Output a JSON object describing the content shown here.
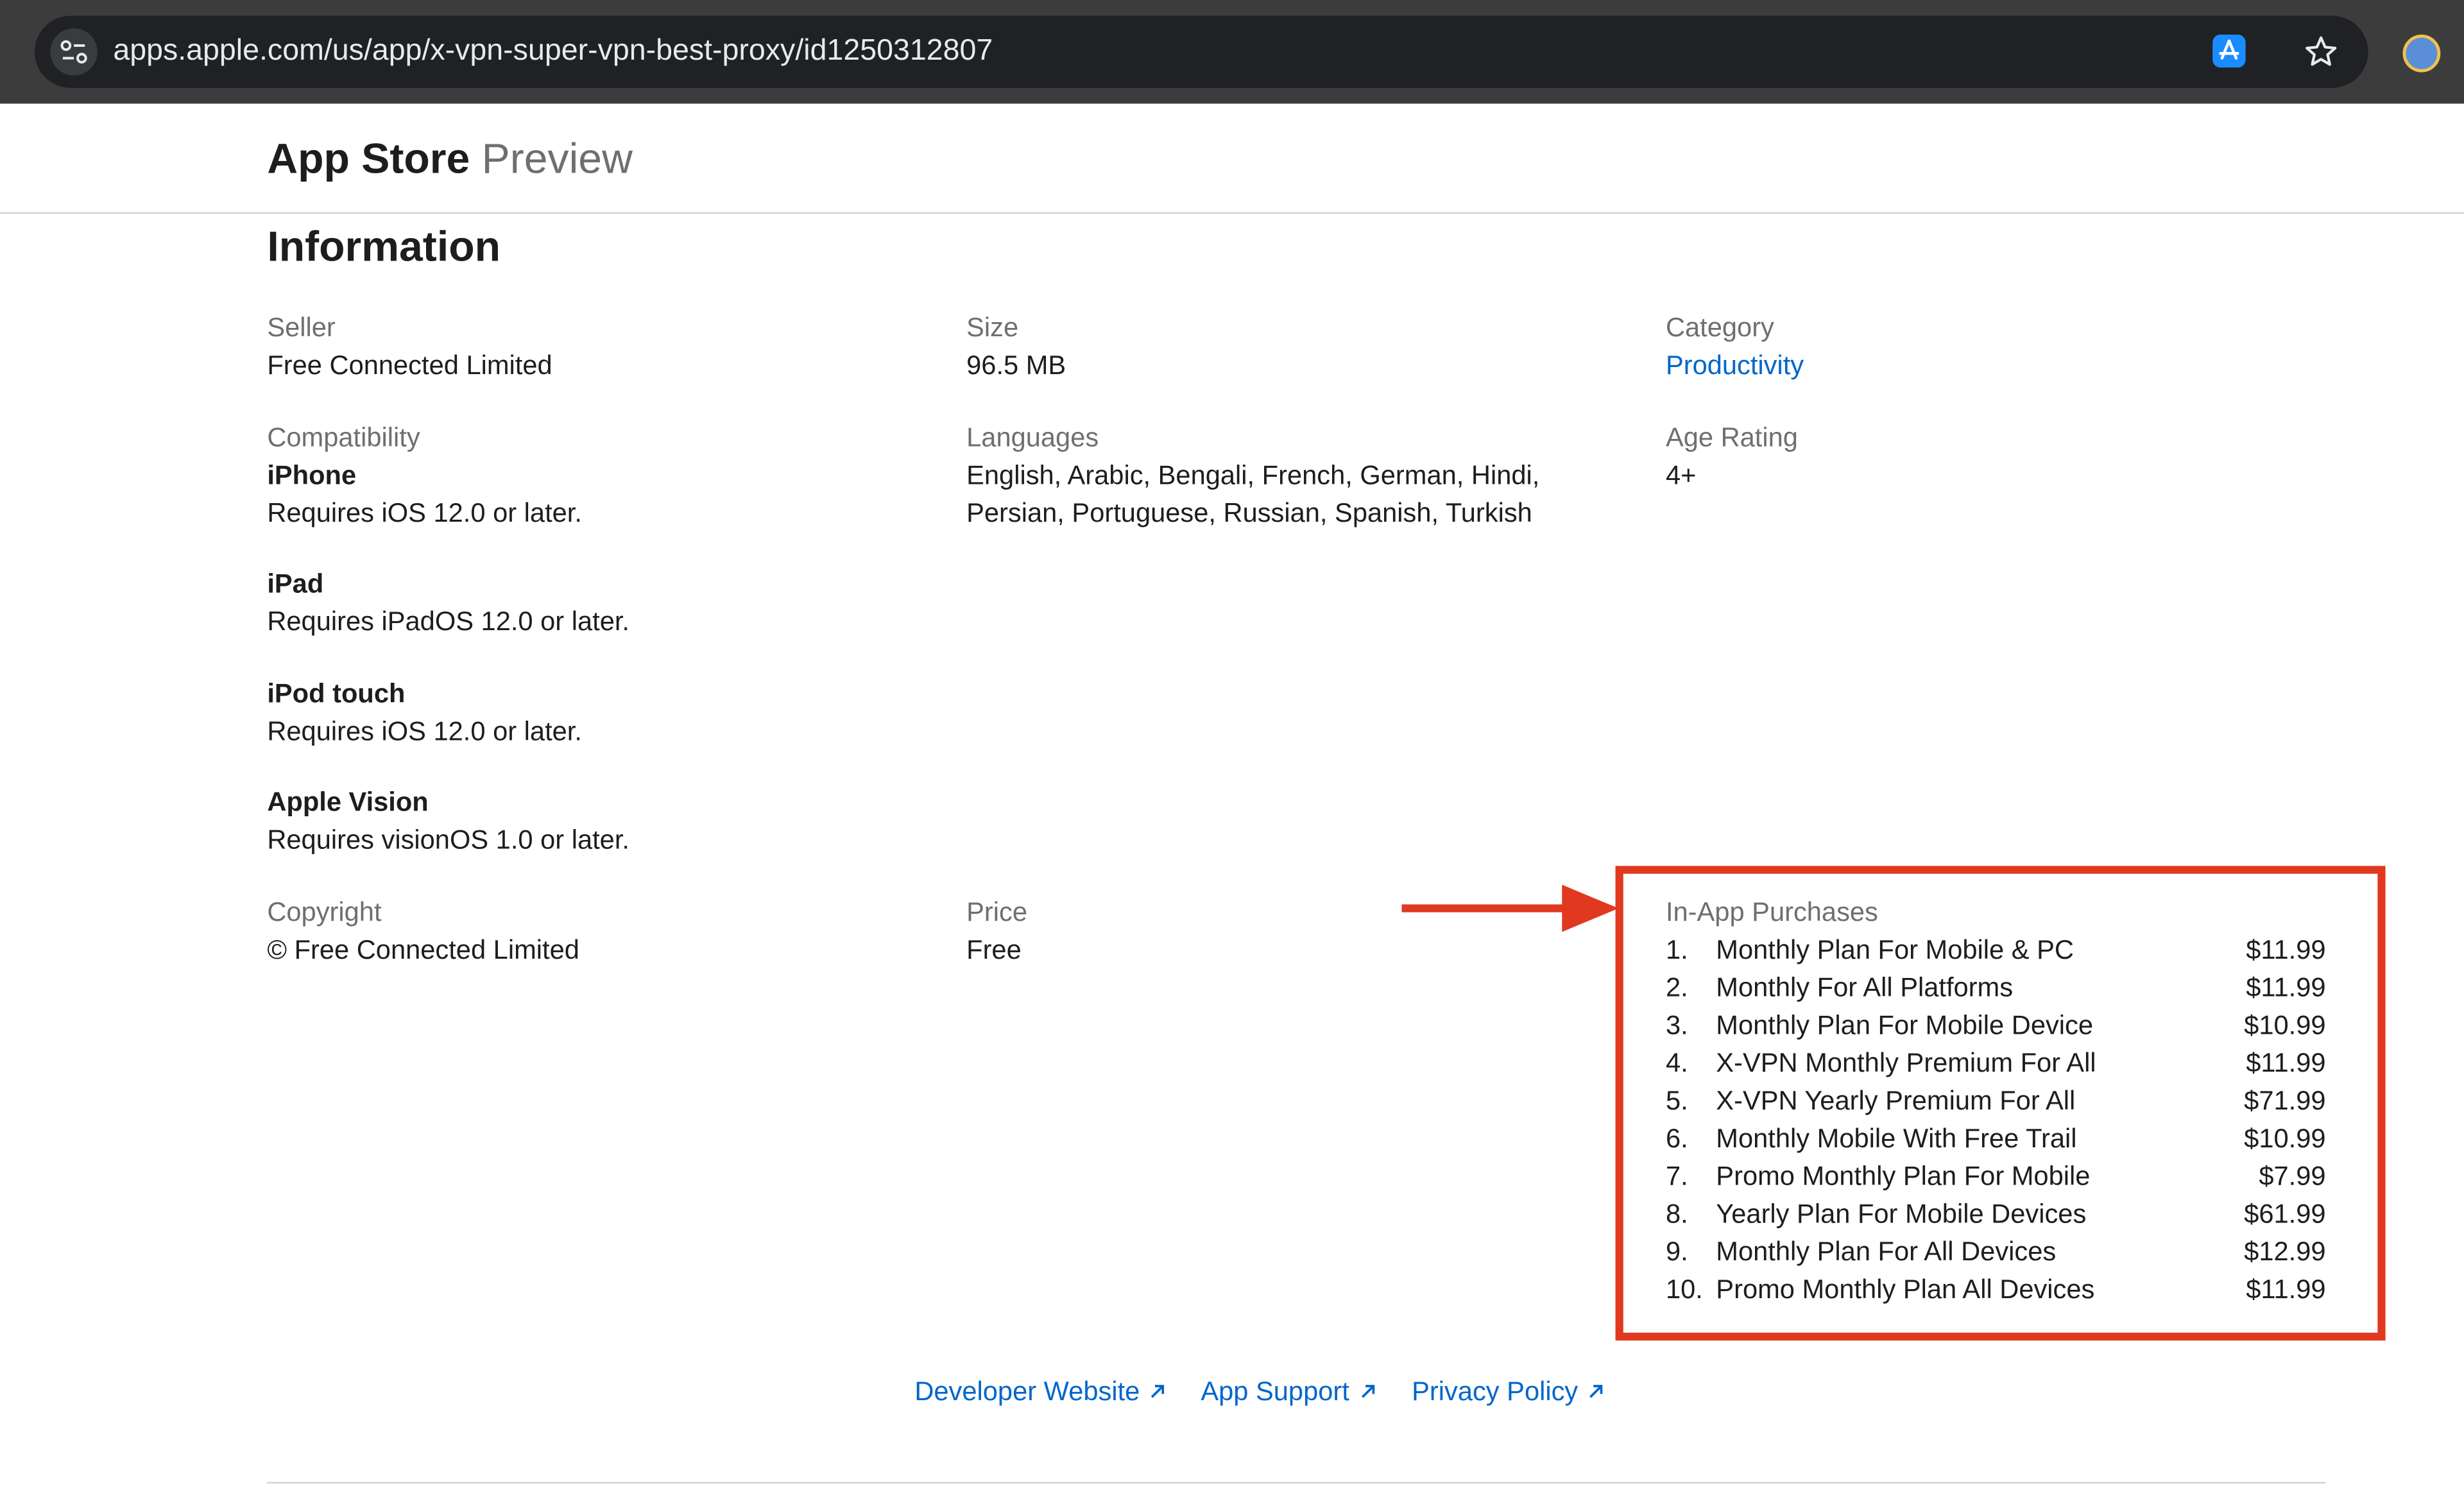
{
  "browser": {
    "url": "apps.apple.com/us/app/x-vpn-super-vpn-best-proxy/id1250312807"
  },
  "header": {
    "brand_strong": "App Store",
    "brand_light": " Preview"
  },
  "information": {
    "title": "Information",
    "seller": {
      "label": "Seller",
      "value": "Free Connected Limited"
    },
    "size": {
      "label": "Size",
      "value": "96.5 MB"
    },
    "category": {
      "label": "Category",
      "value": "Productivity"
    },
    "compatibility": {
      "label": "Compatibility",
      "devices": [
        {
          "name": "iPhone",
          "requirement": "Requires iOS 12.0 or later."
        },
        {
          "name": "iPad",
          "requirement": "Requires iPadOS 12.0 or later."
        },
        {
          "name": "iPod touch",
          "requirement": "Requires iOS 12.0 or later."
        },
        {
          "name": "Apple Vision",
          "requirement": "Requires visionOS 1.0 or later."
        }
      ]
    },
    "languages": {
      "label": "Languages",
      "line1": "English, Arabic, Bengali, French, German, Hindi,",
      "line2": "Persian, Portuguese, Russian, Spanish, Turkish"
    },
    "age_rating": {
      "label": "Age Rating",
      "value": "4+"
    },
    "copyright": {
      "label": "Copyright",
      "value": "© Free Connected Limited"
    },
    "price": {
      "label": "Price",
      "value": "Free"
    },
    "in_app_purchases": {
      "label": "In-App Purchases",
      "items": [
        {
          "num": "1.",
          "name": "Monthly Plan For Mobile & PC",
          "price": "$11.99"
        },
        {
          "num": "2.",
          "name": "Monthly For All Platforms",
          "price": "$11.99"
        },
        {
          "num": "3.",
          "name": "Monthly Plan For Mobile Device",
          "price": "$10.99"
        },
        {
          "num": "4.",
          "name": "X-VPN Monthly Premium For All",
          "price": "$11.99"
        },
        {
          "num": "5.",
          "name": "X-VPN Yearly Premium For All",
          "price": "$71.99"
        },
        {
          "num": "6.",
          "name": "Monthly Mobile With Free Trail",
          "price": "$10.99"
        },
        {
          "num": "7.",
          "name": "Promo Monthly Plan For Mobile",
          "price": "$7.99"
        },
        {
          "num": "8.",
          "name": "Yearly Plan For Mobile Devices",
          "price": "$61.99"
        },
        {
          "num": "9.",
          "name": "Monthly Plan For All Devices",
          "price": "$12.99"
        },
        {
          "num": "10.",
          "name": "Promo Monthly Plan All Devices",
          "price": "$11.99"
        }
      ]
    }
  },
  "footer": {
    "developer_website": "Developer Website",
    "app_support": "App Support",
    "privacy_policy": "Privacy Policy"
  },
  "colors": {
    "annotation": "#e0391f",
    "link": "#0066cc",
    "chrome": "#3c3c3c"
  }
}
